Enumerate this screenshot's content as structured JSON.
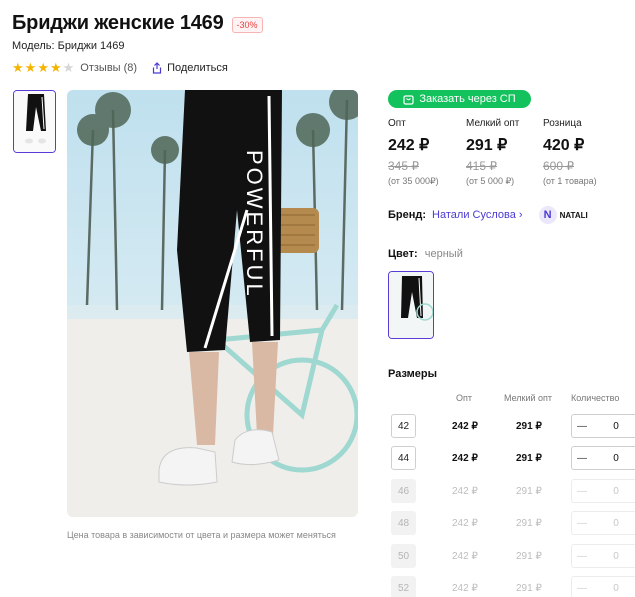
{
  "product": {
    "title": "Бриджи женские 1469",
    "discount": "-30%",
    "model": "Модель: Бриджи 1469",
    "rating": 4,
    "reviews": "Отзывы (8)",
    "share": "Поделиться"
  },
  "photo": {
    "caption": "Цена товара в зависимости от цвета и размера может меняться",
    "print_text": "POWERFUL"
  },
  "order_button": "Заказать через СП",
  "prices": [
    {
      "label": "Опт",
      "now": "242 ₽",
      "old": "345 ₽",
      "min": "(от 35 000₽)"
    },
    {
      "label": "Мелкий опт",
      "now": "291 ₽",
      "old": "415 ₽",
      "min": "(от 5 000 ₽)"
    },
    {
      "label": "Розница",
      "now": "420 ₽",
      "old": "600 ₽",
      "min": "(от 1 товара)"
    }
  ],
  "brand": {
    "label": "Бренд:",
    "name": "Натали Суслова",
    "chevron": "›",
    "logo_text": "NATALI",
    "logo_mark": "N"
  },
  "color": {
    "label": "Цвет:",
    "value": "черный"
  },
  "sizes": {
    "title": "Размеры",
    "headers": {
      "opt": "Опт",
      "small": "Мелкий опт",
      "qty": "Количество"
    },
    "rows": [
      {
        "size": "42",
        "opt": "242 ₽",
        "small": "291 ₽",
        "qty": "0",
        "available": true
      },
      {
        "size": "44",
        "opt": "242 ₽",
        "small": "291 ₽",
        "qty": "0",
        "available": true
      },
      {
        "size": "46",
        "opt": "242 ₽",
        "small": "291 ₽",
        "qty": "0",
        "available": false
      },
      {
        "size": "48",
        "opt": "242 ₽",
        "small": "291 ₽",
        "qty": "0",
        "available": false
      },
      {
        "size": "50",
        "opt": "242 ₽",
        "small": "291 ₽",
        "qty": "0",
        "available": false
      },
      {
        "size": "52",
        "opt": "242 ₽",
        "small": "291 ₽",
        "qty": "0",
        "available": false
      }
    ],
    "minus": "—"
  },
  "colors": {
    "accent": "#5a3bd6",
    "green": "#13c25c",
    "star": "#f4b400",
    "discount": "#e8423f"
  }
}
